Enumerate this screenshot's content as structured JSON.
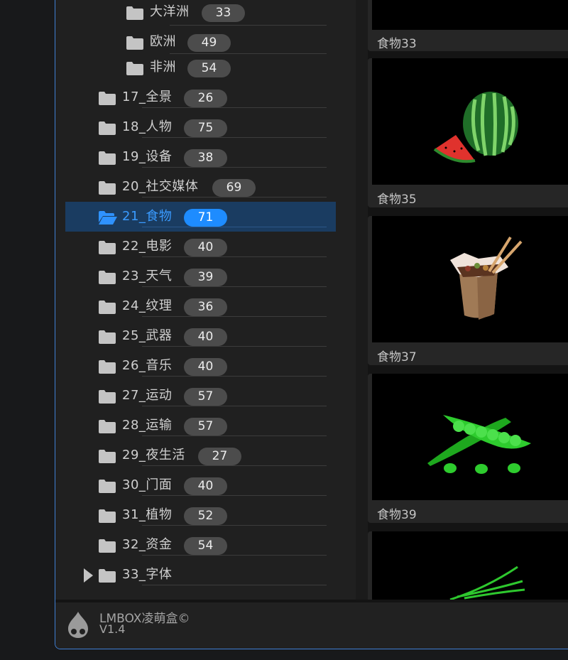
{
  "tree": {
    "items": [
      {
        "label": "大洋洲",
        "count": "33"
      },
      {
        "label": "欧洲",
        "count": "49"
      },
      {
        "label": "非洲",
        "count": "54"
      },
      {
        "label": "17_全景",
        "count": "26"
      },
      {
        "label": "18_人物",
        "count": "75"
      },
      {
        "label": "19_设备",
        "count": "38"
      },
      {
        "label": "20_社交媒体",
        "count": "69"
      },
      {
        "label": "21_食物",
        "count": "71"
      },
      {
        "label": "22_电影",
        "count": "40"
      },
      {
        "label": "23_天气",
        "count": "39"
      },
      {
        "label": "24_纹理",
        "count": "36"
      },
      {
        "label": "25_武器",
        "count": "40"
      },
      {
        "label": "26_音乐",
        "count": "40"
      },
      {
        "label": "27_运动",
        "count": "57"
      },
      {
        "label": "28_运输",
        "count": "57"
      },
      {
        "label": "29_夜生活",
        "count": "27"
      },
      {
        "label": "30_门面",
        "count": "40"
      },
      {
        "label": "31_植物",
        "count": "52"
      },
      {
        "label": "32_资金",
        "count": "54"
      },
      {
        "label": "33_字体",
        "count": ""
      }
    ]
  },
  "gallery": {
    "items": [
      {
        "caption": "食物33",
        "icon": "blank"
      },
      {
        "caption": "食物35",
        "icon": "watermelon"
      },
      {
        "caption": "食物37",
        "icon": "noodle-box"
      },
      {
        "caption": "食物39",
        "icon": "pea-pod"
      },
      {
        "caption": "",
        "icon": "green-onion"
      }
    ]
  },
  "footer": {
    "app_name": "LMBOX凌萌盒©",
    "version": "V1.4"
  },
  "colors": {
    "accent": "#1e8cff",
    "selected_row": "#1a3c61",
    "frame_border": "#3f7fd4"
  }
}
